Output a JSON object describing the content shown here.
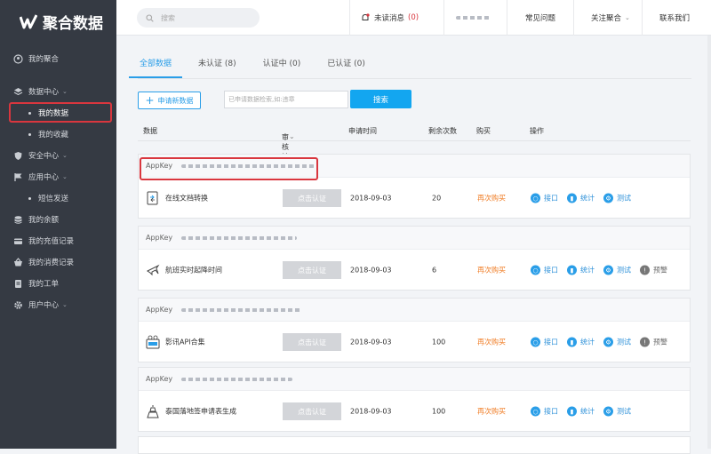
{
  "brand": {
    "name": "聚合数据"
  },
  "sidebar": {
    "items": [
      {
        "label": "我的聚合",
        "icon": "user-circle-icon"
      },
      {
        "label": "数据中心",
        "icon": "layers-icon",
        "expanded": true
      },
      {
        "label": "我的数据",
        "sub": true,
        "active": true
      },
      {
        "label": "我的收藏",
        "sub": true
      },
      {
        "label": "安全中心",
        "icon": "shield-icon",
        "expanded": false
      },
      {
        "label": "应用中心",
        "icon": "flag-icon",
        "expanded": true
      },
      {
        "label": "短信发送",
        "sub": true
      },
      {
        "label": "我的余额",
        "icon": "coins-icon"
      },
      {
        "label": "我的充值记录",
        "icon": "card-icon"
      },
      {
        "label": "我的消费记录",
        "icon": "basket-icon"
      },
      {
        "label": "我的工单",
        "icon": "ticket-icon"
      },
      {
        "label": "用户中心",
        "icon": "gear-icon",
        "expanded": false
      }
    ]
  },
  "topbar": {
    "search_placeholder": "搜索",
    "unread_label": "未读消息",
    "unread_count": "(0)",
    "faq": "常见问题",
    "follow": "关注聚合",
    "contact": "联系我们"
  },
  "tabs": [
    {
      "label": "全部数据",
      "active": true
    },
    {
      "label": "未认证 (8)"
    },
    {
      "label": "认证中 (0)"
    },
    {
      "label": "已认证 (0)"
    }
  ],
  "toolbar": {
    "apply_label": "申请新数据",
    "filter_placeholder": "已申请数据检索,如:违章",
    "search_label": "搜索"
  },
  "table": {
    "headers": {
      "data": "数据",
      "audit": "审核认证",
      "time": "申请时间",
      "remain": "剩余次数",
      "buy": "购买",
      "ops": "操作"
    },
    "appkey_label": "AppKey",
    "rows": [
      {
        "name": "在线文档转换",
        "icon": "document-convert-icon",
        "auth": "点击认证",
        "date": "2018-09-03",
        "remain": "20",
        "buy": "再次购买",
        "ops": [
          "接口",
          "统计",
          "测试"
        ]
      },
      {
        "name": "航班实时起降时间",
        "icon": "airplane-icon",
        "auth": "点击认证",
        "date": "2018-09-03",
        "remain": "6",
        "buy": "再次购买",
        "ops": [
          "接口",
          "统计",
          "测试",
          "预警"
        ]
      },
      {
        "name": "影讯API合集",
        "icon": "film-api-icon",
        "auth": "点击认证",
        "date": "2018-09-03",
        "remain": "100",
        "buy": "再次购买",
        "ops": [
          "接口",
          "统计",
          "测试",
          "预警"
        ]
      },
      {
        "name": "泰国落地签申请表生成",
        "icon": "tower-icon",
        "auth": "点击认证",
        "date": "2018-09-03",
        "remain": "100",
        "buy": "再次购买",
        "ops": [
          "接口",
          "统计",
          "测试"
        ]
      }
    ]
  },
  "colors": {
    "sidebar": "#353a43",
    "accent": "#2a9ee8",
    "buy": "#f07c24",
    "highlight": "#d9363e"
  }
}
